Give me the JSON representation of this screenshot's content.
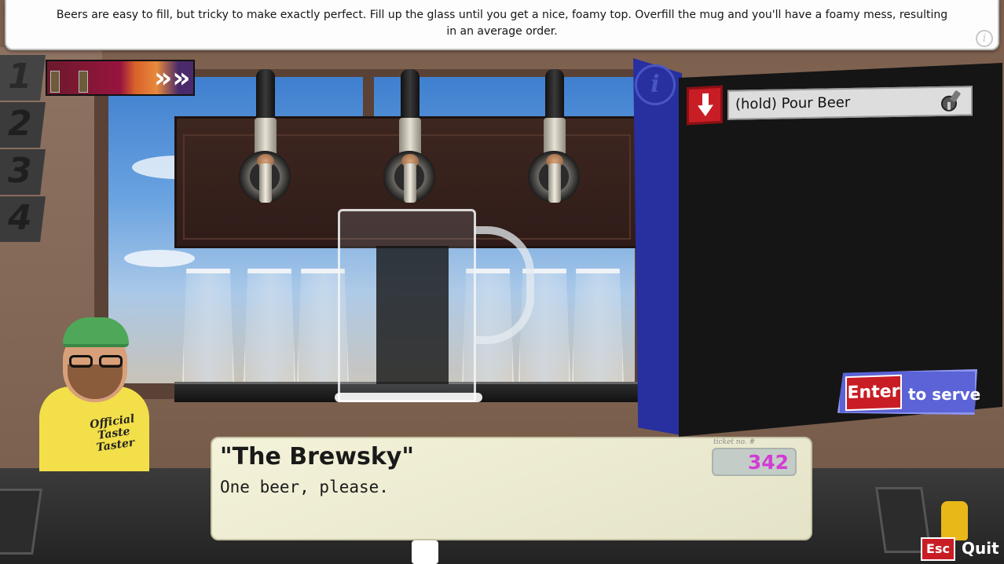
{
  "tip": {
    "text": "Beers are easy to fill, but tricky to make exactly perfect. Fill up the glass until you get a nice, foamy top. Overfill the mug and you'll have a foamy mess, resulting in an average order.",
    "info_glyph": "i"
  },
  "order_slots": [
    {
      "number": "1"
    },
    {
      "number": "2"
    },
    {
      "number": "3"
    },
    {
      "number": "4"
    }
  ],
  "order_strip": {
    "chevrons": "»»"
  },
  "info_tab": {
    "glyph": "i"
  },
  "ticket_steps": [
    {
      "label": "(hold) Pour Beer",
      "icon": "beer-tap-icon",
      "key_icon": "down-arrow-icon"
    }
  ],
  "serve": {
    "key": "Enter",
    "label": "to serve"
  },
  "customer": {
    "name": "\"The Brewsky\"",
    "line": "One beer, please.",
    "shirt_text": "Official Taste Taster"
  },
  "ticket": {
    "label": "ticket no. #",
    "number": "342"
  },
  "quit": {
    "key": "Esc",
    "label": "Quit"
  },
  "colors": {
    "accent_red": "#c81d25",
    "panel_blue": "#27309e",
    "serve_blue": "#5b63d6",
    "ticket_number": "#d43bd6",
    "dialog_bg": "#f4f3da"
  }
}
